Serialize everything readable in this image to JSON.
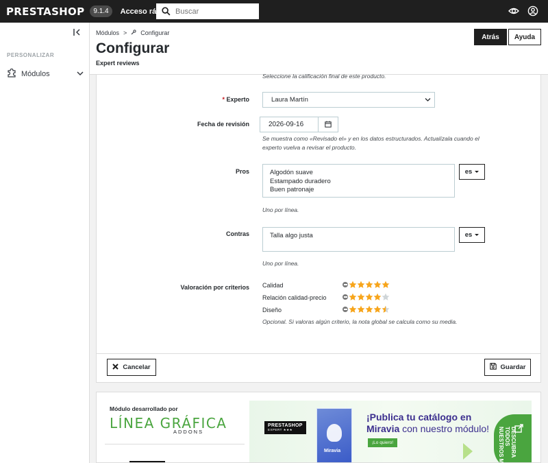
{
  "header": {
    "logo": "PRESTASHOP",
    "version": "9.1.4",
    "quick_access": "Acceso rápido",
    "search_placeholder": "Buscar"
  },
  "sidebar": {
    "section": "PERSONALIZAR",
    "item": "Módulos"
  },
  "page": {
    "breadcrumb_parent": "Módulos",
    "breadcrumb_current": "Configurar",
    "title": "Configurar",
    "subtitle": "Expert reviews",
    "back_label": "Atrás",
    "help_label": "Ayuda"
  },
  "form": {
    "top_help": "Seleccione la calificación final de este producto.",
    "expert_label": "Experto",
    "expert_value": "Laura Martín",
    "date_label": "Fecha de revisión",
    "date_value": "2026-09-16",
    "date_help_1": "Se muestra como «Revisado el» y en los datos estructurados. Actualízala cuando el",
    "date_help_2": "experto vuelva a revisar el producto.",
    "pros_label": "Pros",
    "pros_lines": [
      "Algodón suave",
      "Estampado duradero",
      "Buen patronaje"
    ],
    "pros_lang": "es",
    "pros_help": "Uno por línea.",
    "cons_label": "Contras",
    "cons_lines": [
      "Talla algo justa"
    ],
    "cons_lang": "es",
    "cons_help": "Uno por línea.",
    "criteria_label": "Valoración por criterios",
    "criteria": [
      {
        "name": "Calidad",
        "rating": 5
      },
      {
        "name": "Relación calidad-precio",
        "rating": 4
      },
      {
        "name": "Diseño",
        "rating": 4.5
      }
    ],
    "criteria_help": "Opcional. Si valoras algún criterio, la nota global se calcula como su media.",
    "cancel_label": "Cancelar",
    "save_label": "Guardar"
  },
  "promo": {
    "developed_by": "Módulo desarrollado por",
    "company": "LÍNEA GRÁFICA",
    "company_sub": "ADDONS",
    "badge": "PRESTASHOP",
    "badge_sub": "EXPERT ★★★",
    "box_label": "Miravia",
    "headline_1": "¡Publica tu catálogo en",
    "headline_2_bold": "Miravia",
    "headline_2_rest": " con nuestro módulo!",
    "cta": "¡Lo quiero!",
    "side_text": "DESCUBRA TODOS NUESTROS MÓ"
  },
  "colors": {
    "star_on": "#f7a51b",
    "star_off": "#cfd5d8",
    "brand_green": "#4aa53f",
    "topbar": "#1f1f1f"
  }
}
